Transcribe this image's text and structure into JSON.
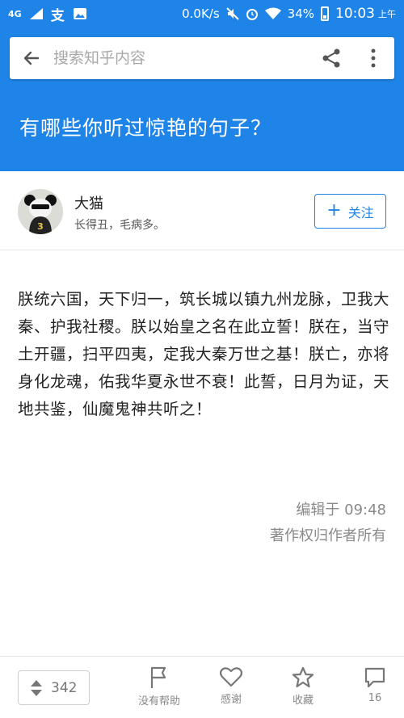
{
  "status_bar": {
    "signal": "4G",
    "speed": "0.0K/s",
    "battery": "34%",
    "time": "10:03",
    "ampm": "上午"
  },
  "search": {
    "placeholder": "搜索知乎内容"
  },
  "question": {
    "title": "有哪些你听过惊艳的句子？"
  },
  "author": {
    "name": "大猫",
    "bio": "长得丑，毛病多。",
    "follow_label": "关注"
  },
  "answer": {
    "content": "朕统六国，天下归一，筑长城以镇九州龙脉，卫我大秦、护我社稷。朕以始皇之名在此立誓！朕在，当守土开疆，扫平四夷，定我大秦万世之基！朕亡，亦将身化龙魂，佑我华夏永世不衰！此誓，日月为证，天地共鉴，仙魔鬼神共听之！",
    "edited": "编辑于 09:48",
    "copyright": "著作权归作者所有"
  },
  "bottom_bar": {
    "votes": "342",
    "not_helpful": "没有帮助",
    "thanks": "感谢",
    "collect": "收藏",
    "comments": "16"
  },
  "colors": {
    "brand": "#1f84e8",
    "text": "#222222",
    "muted": "#8a8a8a"
  }
}
